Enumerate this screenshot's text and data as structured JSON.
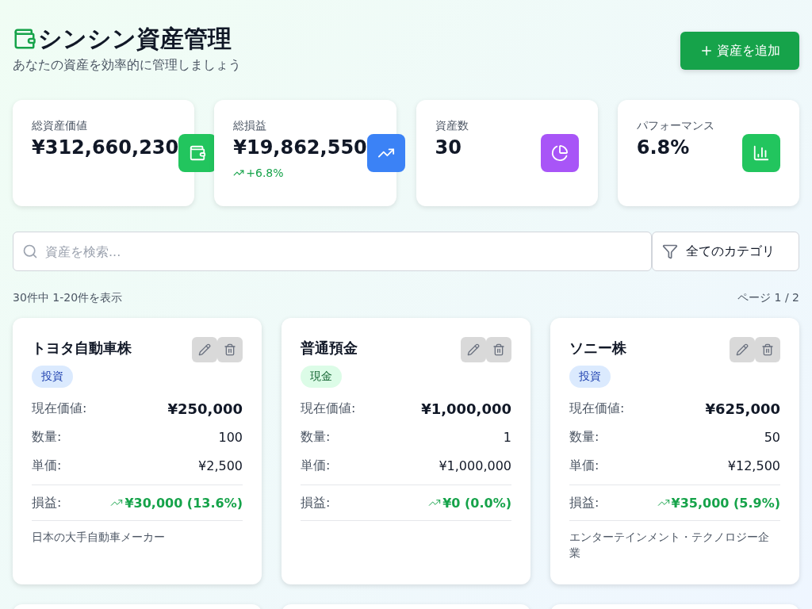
{
  "header": {
    "title": "シンシン資産管理",
    "subtitle": "あなたの資産を効率的に管理しましょう",
    "add_button": "資産を追加"
  },
  "stats": [
    {
      "label": "総資産価値",
      "value": "¥312,660,230",
      "color": "#22c55e"
    },
    {
      "label": "総損益",
      "value": "¥19,862,550",
      "change": "+6.8%",
      "color": "#3b82f6"
    },
    {
      "label": "資産数",
      "value": "30",
      "color": "#a855f7"
    },
    {
      "label": "パフォーマンス",
      "value": "6.8%",
      "color": "#22c55e"
    }
  ],
  "search": {
    "placeholder": "資産を検索..."
  },
  "category_filter": "全てのカテゴリ",
  "result_count": "30件中 1-20件を表示",
  "page_indicator": "ページ 1 / 2",
  "assets": [
    {
      "name": "トヨタ自動車株",
      "category": "投資",
      "kind": "investment",
      "current_value_label": "現在価値:",
      "current_value": "¥250,000",
      "quantity_label": "数量:",
      "quantity": "100",
      "unit_price_label": "単価:",
      "unit_price": "¥2,500",
      "pl_label": "損益:",
      "pl": "¥30,000 (13.6%)",
      "description": "日本の大手自動車メーカー"
    },
    {
      "name": "普通預金",
      "category": "現金",
      "kind": "cash",
      "current_value_label": "現在価値:",
      "current_value": "¥1,000,000",
      "quantity_label": "数量:",
      "quantity": "1",
      "unit_price_label": "単価:",
      "unit_price": "¥1,000,000",
      "pl_label": "損益:",
      "pl": "¥0 (0.0%)"
    },
    {
      "name": "ソニー株",
      "category": "投資",
      "kind": "investment",
      "current_value_label": "現在価値:",
      "current_value": "¥625,000",
      "quantity_label": "数量:",
      "quantity": "50",
      "unit_price_label": "単価:",
      "unit_price": "¥12,500",
      "pl_label": "損益:",
      "pl": "¥35,000 (5.9%)",
      "description": "エンターテインメント・テクノロジー企業"
    }
  ]
}
